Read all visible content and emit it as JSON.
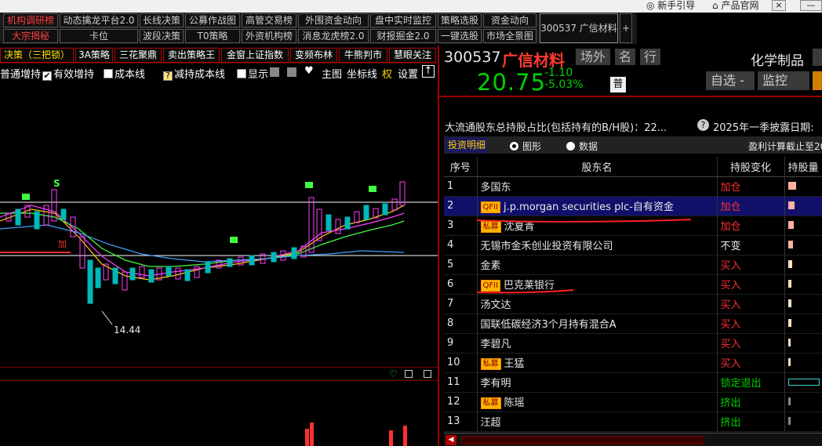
{
  "titlebar": {
    "guide": "新手引导",
    "site": "产品官网",
    "close": "×",
    "min": "—"
  },
  "menu_row1": [
    "机构调研榜",
    "动态擒龙平台2.0",
    "长线决策",
    "公募作战图",
    "高管交易榜",
    "外围资金动向",
    "盘中实时监控",
    "策略选股",
    "资金动向"
  ],
  "menu_row2": [
    "大宗揭秘",
    "卡位",
    "波段决策",
    "T0策略",
    "外资机构榜",
    "消息龙虎榜2.0",
    "财报掘金2.0",
    "一键选股",
    "市场全景图"
  ],
  "menu_active_stock": "300537 广信材料",
  "menu_plus": "+",
  "tabs": [
    "决策（三把锁）",
    "3A策略",
    "三花聚鼎",
    "卖出策略王",
    "金窗上证指数",
    "变频布林",
    "牛熊判市",
    "慧眼关注"
  ],
  "chart_options": {
    "opt1": "普通增持",
    "opt2": "有效增持",
    "opt3": "成本线",
    "opt4": "减持成本线",
    "opt5": "显示",
    "main": "主图",
    "axis": "坐标线",
    "right": "权",
    "settings": "设置",
    "check": "✔"
  },
  "chart": {
    "low_label": "14.44",
    "buy_marker": "S",
    "bs_marker": "加"
  },
  "stock": {
    "code": "300537",
    "name": "广信材料",
    "tag1": "场外",
    "tag2": "名",
    "tag3": "行",
    "industry": "化学制品",
    "price": "20.75",
    "change": "-1.10",
    "change_pct": "-5.03%",
    "pu": "普",
    "watch_btn": "自选 -",
    "monitor_btn": "监控"
  },
  "shareholders": {
    "title": "大流通股东总持股占比(包括持有的B/H股)：22...",
    "disclose": "2025年一季披露日期:",
    "tab_detail": "投资明细",
    "radio_chart": "图形",
    "radio_data": "数据",
    "profit_note": "盈利计算截止至20",
    "headers": [
      "序号",
      "股东名",
      "持股变化",
      "持股量"
    ],
    "rows": [
      {
        "no": "1",
        "badge": "",
        "name": "多国东",
        "change": "加仓",
        "ctype": "add",
        "bar": 0.8
      },
      {
        "no": "2",
        "badge": "QFII",
        "name": "j.p.morgan securities plc-自有资金",
        "change": "加仓",
        "ctype": "add",
        "bar": 0.7
      },
      {
        "no": "3",
        "badge": "私募",
        "name": "沈夏青",
        "change": "加仓",
        "ctype": "add",
        "bar": 0.6
      },
      {
        "no": "4",
        "badge": "",
        "name": "无锡市金禾创业投资有限公司",
        "change": "不变",
        "ctype": "same",
        "bar": 0.5
      },
      {
        "no": "5",
        "badge": "",
        "name": "金素",
        "change": "买入",
        "ctype": "buy",
        "bar": 0.4
      },
      {
        "no": "6",
        "badge": "QFII",
        "name": "巴克莱银行",
        "change": "买入",
        "ctype": "buy",
        "bar": 0.35
      },
      {
        "no": "7",
        "badge": "",
        "name": "汤文达",
        "change": "买入",
        "ctype": "buy",
        "bar": 0.3
      },
      {
        "no": "8",
        "badge": "",
        "name": "国联低碳经济3个月持有混合A",
        "change": "买入",
        "ctype": "buy",
        "bar": 0.3
      },
      {
        "no": "9",
        "badge": "",
        "name": "李碧凡",
        "change": "买入",
        "ctype": "buy",
        "bar": 0.25
      },
      {
        "no": "10",
        "badge": "私募",
        "name": "王猛",
        "change": "买入",
        "ctype": "buy",
        "bar": 0.25
      },
      {
        "no": "11",
        "badge": "",
        "name": "李有明",
        "change": "锁定退出",
        "ctype": "lock",
        "bar": 0
      },
      {
        "no": "12",
        "badge": "私募",
        "name": "陈瑶",
        "change": "挤出",
        "ctype": "out",
        "bar": 0.2
      },
      {
        "no": "13",
        "badge": "",
        "name": "汪超",
        "change": "挤出",
        "ctype": "out",
        "bar": 0.2
      }
    ]
  },
  "colors": {
    "up": "#ff3030",
    "down": "#00d000",
    "accent_red": "#9a0000",
    "select": "#10106a"
  }
}
